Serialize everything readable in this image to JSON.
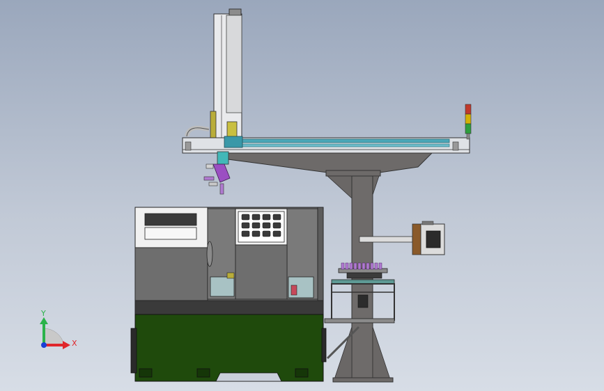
{
  "viewport": {
    "background_top": "#9aa7bc",
    "background_bottom": "#d7dde6"
  },
  "machine": {
    "lathe_body_color": "#6b6b6b",
    "base_color": "#1f4a0c",
    "beam_color": "#4aa7b8",
    "gripper_color": "#9b4fc2",
    "stack_light_colors": [
      "#c0392b",
      "#d4b106",
      "#2e9e3e"
    ]
  },
  "triad": {
    "y_label": "Y",
    "x_label": "X",
    "y_color": "#2bb34a",
    "x_color": "#e0262b",
    "z_color": "#1a3fd6"
  }
}
